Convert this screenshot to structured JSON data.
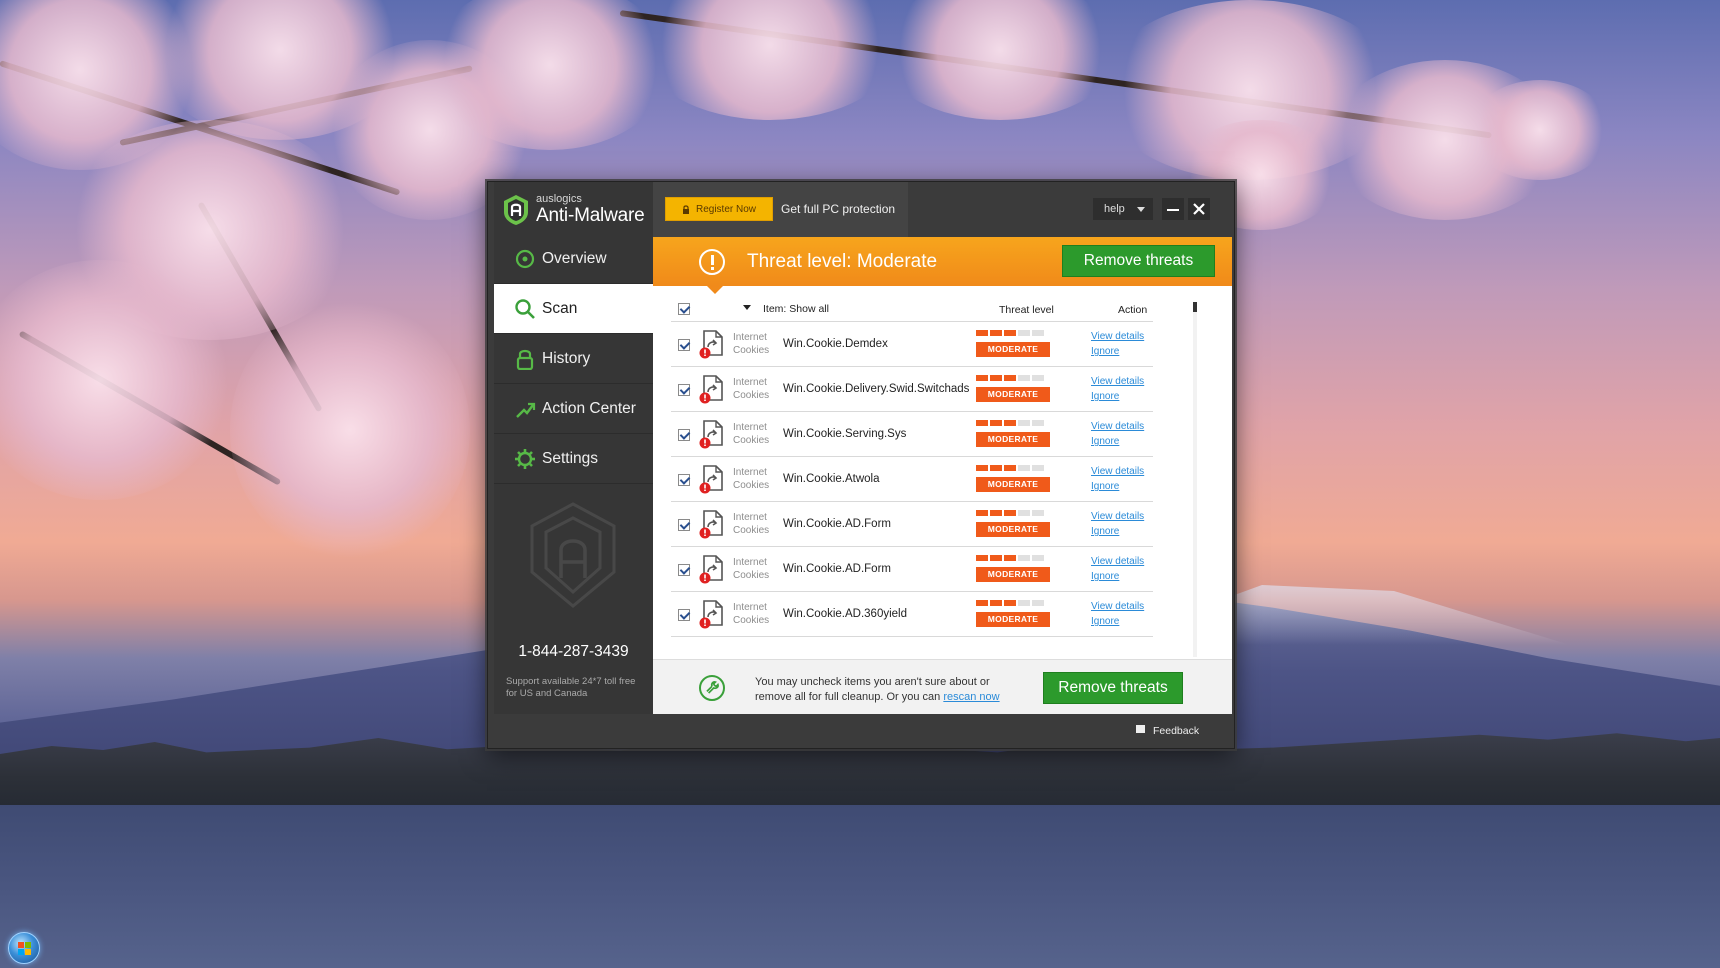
{
  "app": {
    "brand_small": "auslogics",
    "brand_name": "Anti-Malware"
  },
  "topbar": {
    "register_label": "Register Now",
    "promo_text": "Get full PC protection",
    "help_label": "help"
  },
  "nav": {
    "items": [
      {
        "label": "Overview",
        "icon": "circle-dot-icon"
      },
      {
        "label": "Scan",
        "icon": "magnifier-icon",
        "active": true
      },
      {
        "label": "History",
        "icon": "padlock-icon"
      },
      {
        "label": "Action Center",
        "icon": "arrows-icon"
      },
      {
        "label": "Settings",
        "icon": "gear-icon"
      }
    ]
  },
  "support": {
    "phone": "1-844-287-3439",
    "note": "Support available 24*7 toll free for US and Canada"
  },
  "threat": {
    "title": "Threat level: Moderate",
    "remove_label": "Remove threats"
  },
  "table": {
    "head_item": "Item: Show all",
    "head_level": "Threat level",
    "head_action": "Action",
    "rows": [
      {
        "cat1": "Internet",
        "cat2": "Cookies",
        "name": "Win.Cookie.Demdex",
        "level": "MODERATE",
        "view": "View details",
        "ignore": "Ignore",
        "bars_on": 3,
        "bars_total": 5
      },
      {
        "cat1": "Internet",
        "cat2": "Cookies",
        "name": "Win.Cookie.Delivery.Swid.Switchads",
        "level": "MODERATE",
        "view": "View details",
        "ignore": "Ignore",
        "bars_on": 3,
        "bars_total": 5
      },
      {
        "cat1": "Internet",
        "cat2": "Cookies",
        "name": "Win.Cookie.Serving.Sys",
        "level": "MODERATE",
        "view": "View details",
        "ignore": "Ignore",
        "bars_on": 3,
        "bars_total": 5
      },
      {
        "cat1": "Internet",
        "cat2": "Cookies",
        "name": "Win.Cookie.Atwola",
        "level": "MODERATE",
        "view": "View details",
        "ignore": "Ignore",
        "bars_on": 3,
        "bars_total": 5
      },
      {
        "cat1": "Internet",
        "cat2": "Cookies",
        "name": "Win.Cookie.AD.Form",
        "level": "MODERATE",
        "view": "View details",
        "ignore": "Ignore",
        "bars_on": 3,
        "bars_total": 5
      },
      {
        "cat1": "Internet",
        "cat2": "Cookies",
        "name": "Win.Cookie.AD.Form",
        "level": "MODERATE",
        "view": "View details",
        "ignore": "Ignore",
        "bars_on": 3,
        "bars_total": 5
      },
      {
        "cat1": "Internet",
        "cat2": "Cookies",
        "name": "Win.Cookie.AD.360yield",
        "level": "MODERATE",
        "view": "View details",
        "ignore": "Ignore",
        "bars_on": 3,
        "bars_total": 5
      }
    ]
  },
  "footer": {
    "text": "You may uncheck items you aren't sure about or remove all for full cleanup. Or you can",
    "rescan_label": "rescan now",
    "remove_label": "Remove threats",
    "feedback_label": "Feedback"
  },
  "colors": {
    "accent_green": "#2c9a2c",
    "threat_orange": "#f7a51c",
    "badge_red": "#f05a1a",
    "register_yellow": "#f4b400",
    "link_blue": "#2b8bd8"
  }
}
